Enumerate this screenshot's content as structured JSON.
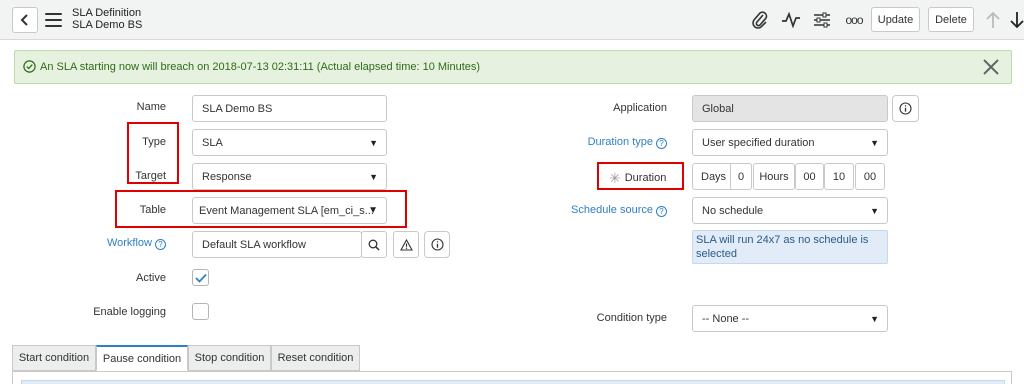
{
  "header": {
    "title": "SLA Definition",
    "subtitle": "SLA Demo BS",
    "update_label": "Update",
    "delete_label": "Delete",
    "more_label": "ooo"
  },
  "alert": {
    "text": "An SLA starting now will breach on 2018-07-13 02:31:11 (Actual elapsed time: 10 Minutes)"
  },
  "form": {
    "name": {
      "label": "Name",
      "value": "SLA Demo BS"
    },
    "type": {
      "label": "Type",
      "value": "SLA"
    },
    "target": {
      "label": "Target",
      "value": "Response"
    },
    "table": {
      "label": "Table",
      "value": "Event Management SLA [em_ci_s..."
    },
    "workflow": {
      "label": "Workflow",
      "value": "Default SLA workflow"
    },
    "active": {
      "label": "Active",
      "checked": true
    },
    "enable_logging": {
      "label": "Enable logging",
      "checked": false
    },
    "application": {
      "label": "Application",
      "value": "Global"
    },
    "duration_type": {
      "label": "Duration type",
      "value": "User specified duration"
    },
    "duration": {
      "label": "Duration",
      "days_label": "Days",
      "days_value": "0",
      "hours_label": "Hours",
      "hours_value": "00",
      "minutes_value": "10",
      "seconds_value": "00"
    },
    "schedule_source": {
      "label": "Schedule source",
      "value": "No schedule"
    },
    "schedule_info": "SLA will run 24x7 as no schedule is selected",
    "condition_type": {
      "label": "Condition type",
      "value": "-- None --"
    }
  },
  "tabs": [
    {
      "label": "Start condition"
    },
    {
      "label": "Pause condition"
    },
    {
      "label": "Stop condition"
    },
    {
      "label": "Reset condition"
    }
  ],
  "colors": {
    "accent": "#2f80c6",
    "highlight_box": "#e00000",
    "alert_bg": "#e6f2df",
    "alert_text": "#2e6b18"
  }
}
